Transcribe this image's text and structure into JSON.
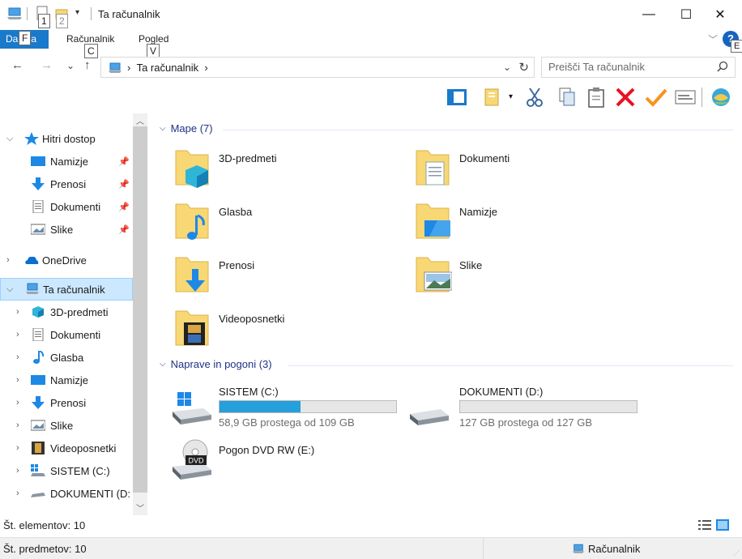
{
  "window": {
    "title": "Ta računalnik",
    "minimize_glyph": "—",
    "maximize_glyph": "☐",
    "close_glyph": "✕"
  },
  "keytips": {
    "qat1": "1",
    "qat2": "2",
    "file": "F",
    "computer": "C",
    "view": "V",
    "help": "E"
  },
  "ribbon": {
    "file_tab": "Da  eka",
    "tabs": [
      "Računalnik",
      "Pogled"
    ],
    "help": "?"
  },
  "address": {
    "back": "←",
    "forward": "→",
    "recent": "⌄",
    "up": "↑",
    "path": "Ta računalnik",
    "refresh": "↻"
  },
  "search": {
    "placeholder": "Preišči Ta računalnik"
  },
  "navpane": {
    "quick_access": "Hitri dostop",
    "quick_items": [
      "Namizje",
      "Prenosi",
      "Dokumenti",
      "Slike"
    ],
    "onedrive": "OneDrive",
    "this_pc": "Ta računalnik",
    "pc_items": [
      "3D-predmeti",
      "Dokumenti",
      "Glasba",
      "Namizje",
      "Prenosi",
      "Slike",
      "Videoposnetki",
      "SISTEM (C:)",
      "DOKUMENTI (D:"
    ]
  },
  "content": {
    "folders_header": "Mape (7)",
    "folders": [
      "3D-predmeti",
      "Dokumenti",
      "Glasba",
      "Namizje",
      "Prenosi",
      "Slike",
      "Videoposnetki"
    ],
    "drives_header": "Naprave in pogoni (3)",
    "drives": [
      {
        "name": "SISTEM (C:)",
        "free": "58,9 GB prostega od 109 GB",
        "used_fraction": 0.46
      },
      {
        "name": "DOKUMENTI (D:)",
        "free": "127 GB prostega od 127 GB",
        "used_fraction": 0.0
      },
      {
        "name": "Pogon DVD RW (E:)"
      }
    ],
    "dvd_badge": "DVD"
  },
  "footer": {
    "items_count": "Št. elementov: 10",
    "status_left": "Št. predmetov: 10",
    "status_right": "Računalnik"
  },
  "colors": {
    "accent": "#1979ca",
    "selection": "#cce8ff",
    "drive_fill": "#26a0da",
    "folder": "#f8d775",
    "delete_red": "#e81123",
    "check_orange": "#f7941d"
  }
}
